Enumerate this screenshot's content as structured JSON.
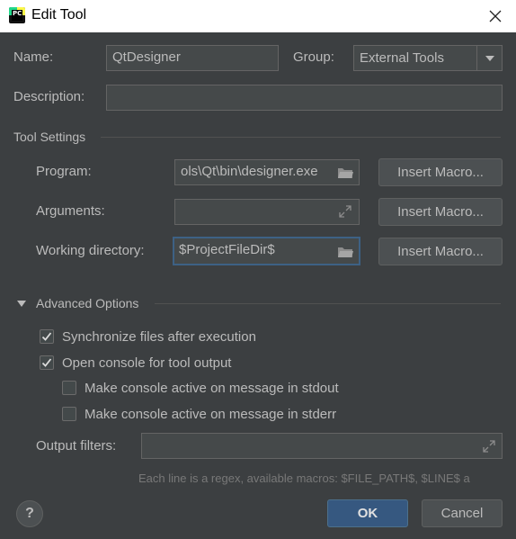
{
  "window": {
    "title": "Edit Tool",
    "app_icon": "pycharm-logo",
    "app_icon_text": "PC"
  },
  "name": {
    "label": "Name:",
    "value": "QtDesigner"
  },
  "group": {
    "label": "Group:",
    "value": "External Tools"
  },
  "description": {
    "label": "Description:",
    "value": ""
  },
  "tool_settings": {
    "title": "Tool Settings",
    "program": {
      "label": "Program:",
      "value": "ols\\Qt\\bin\\designer.exe",
      "macro_button": "Insert Macro..."
    },
    "arguments": {
      "label": "Arguments:",
      "value": "",
      "macro_button": "Insert Macro..."
    },
    "working_directory": {
      "label": "Working directory:",
      "value": "$ProjectFileDir$",
      "macro_button": "Insert Macro..."
    }
  },
  "advanced": {
    "title": "Advanced Options",
    "options": [
      {
        "label": "Synchronize files after execution",
        "checked": true
      },
      {
        "label": "Open console for tool output",
        "checked": true
      },
      {
        "label": "Make console active on message in stdout",
        "checked": false
      },
      {
        "label": "Make console active on message in stderr",
        "checked": false
      }
    ],
    "output_filters": {
      "label": "Output filters:",
      "value": ""
    },
    "hint": "Each line is a regex, available macros: $FILE_PATH$, $LINE$ a"
  },
  "footer": {
    "help": "?",
    "ok": "OK",
    "cancel": "Cancel"
  },
  "colors": {
    "background": "#3c3f41",
    "primary_button": "#365880",
    "focus_border": "#3d6185",
    "text": "#bbbbbb"
  }
}
